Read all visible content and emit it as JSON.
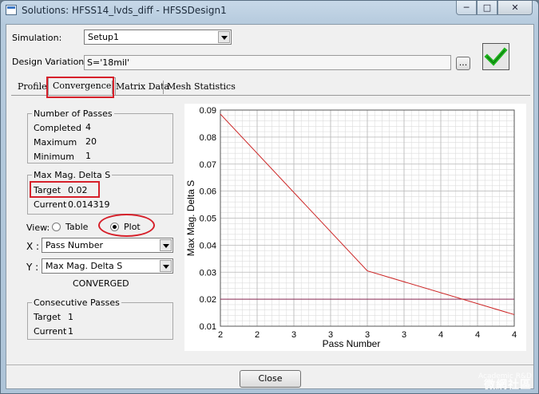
{
  "window": {
    "title": "Solutions: HFSS14_lvds_diff - HFSSDesign1",
    "controls": {
      "minimize": "─",
      "maximize": "□",
      "close": "✕"
    }
  },
  "simulation": {
    "label": "Simulation:",
    "value": "Setup1"
  },
  "design_variation": {
    "label": "Design Variation:",
    "value": "S='18mil'",
    "browse_label": "..."
  },
  "tabs": [
    {
      "label": "Profile",
      "active": false
    },
    {
      "label": "Convergence",
      "active": true
    },
    {
      "label": "Matrix Data",
      "active": false
    },
    {
      "label": "Mesh Statistics",
      "active": false
    }
  ],
  "number_of_passes": {
    "title": "Number of Passes",
    "rows": [
      {
        "label": "Completed",
        "value": "4"
      },
      {
        "label": "Maximum",
        "value": "20"
      },
      {
        "label": "Minimum",
        "value": "1"
      }
    ]
  },
  "max_mag_delta_s": {
    "title": "Max Mag. Delta S",
    "target_label": "Target",
    "target_value": "0.02",
    "current_label": "Current",
    "current_value": "0.014319"
  },
  "view": {
    "label": "View:",
    "options": [
      "Table",
      "Plot"
    ],
    "selected": "Plot"
  },
  "x_axis_select": {
    "label": "X :",
    "value": "Pass Number"
  },
  "y_axis_select": {
    "label": "Y :",
    "value": "Max Mag. Delta S"
  },
  "status": "CONVERGED",
  "consecutive_passes": {
    "title": "Consecutive Passes",
    "target_label": "Target",
    "target_value": "1",
    "current_label": "Current",
    "current_value": "1"
  },
  "close_button": "Close",
  "watermark": {
    "line1": "Academic R&D",
    "line2": "微網社區"
  },
  "colors": {
    "highlight": "#d6202a",
    "series": "#cc2222",
    "target_line": "#8a2a55",
    "grid": "#dcdcdc",
    "checkmark": "#1db31d"
  },
  "chart_data": {
    "type": "line",
    "xlabel": "Pass Number",
    "ylabel": "Max Mag. Delta S",
    "x_tick_labels": [
      "2",
      "2",
      "3",
      "3",
      "3",
      "3",
      "4",
      "4",
      "4"
    ],
    "y_tick_labels": [
      "0.01",
      "0.02",
      "0.03",
      "0.04",
      "0.05",
      "0.06",
      "0.07",
      "0.08",
      "0.09"
    ],
    "xlim": [
      2,
      4
    ],
    "ylim": [
      0.01,
      0.09
    ],
    "grid": true,
    "series": [
      {
        "x": [
          2,
          3,
          4
        ],
        "y": [
          0.0885,
          0.0305,
          0.0143
        ]
      }
    ],
    "target": 0.02
  }
}
